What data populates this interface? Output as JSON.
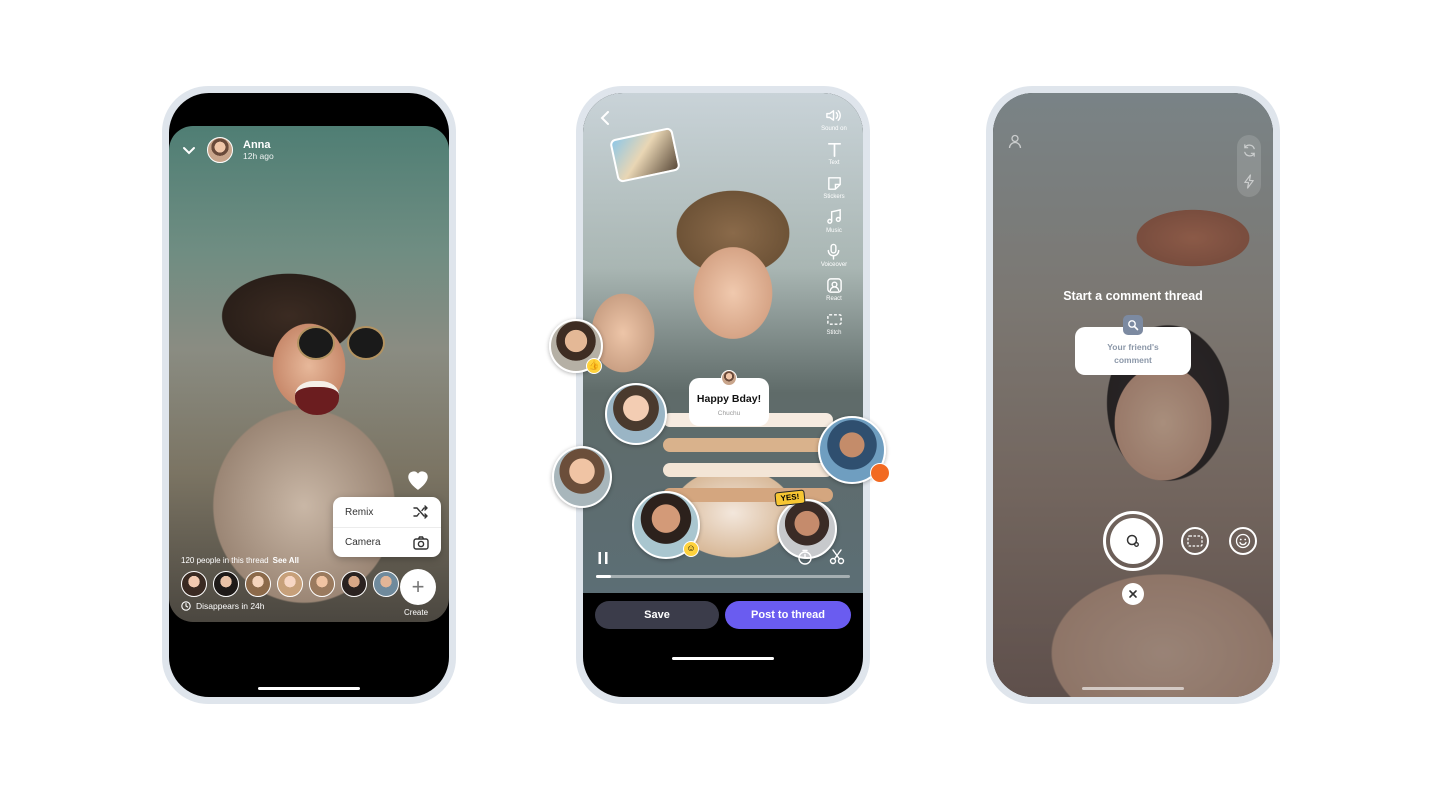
{
  "post_view": {
    "author": {
      "name": "Anna",
      "time": "12h ago"
    },
    "menu": {
      "remix_label": "Remix",
      "camera_label": "Camera"
    },
    "thread": {
      "count_text": "120 people in this thread",
      "see_all_label": "See All"
    },
    "participants": [
      "participant-1",
      "participant-2",
      "participant-3",
      "participant-4",
      "participant-5",
      "participant-6",
      "participant-7"
    ],
    "create_label": "Create",
    "disappears_text": "Disappears in 24h"
  },
  "editor": {
    "tools": [
      {
        "name": "sound",
        "label": "Sound on",
        "icon": "speaker-icon"
      },
      {
        "name": "text",
        "label": "Text",
        "icon": "text-icon"
      },
      {
        "name": "stickers",
        "label": "Stickers",
        "icon": "sticker-icon"
      },
      {
        "name": "music",
        "label": "Music",
        "icon": "music-icon"
      },
      {
        "name": "voiceover",
        "label": "Voiceover",
        "icon": "mic-icon"
      },
      {
        "name": "react",
        "label": "React",
        "icon": "react-icon"
      },
      {
        "name": "stitch",
        "label": "Stitch",
        "icon": "stitch-icon"
      }
    ],
    "comment_bubble": {
      "title": "Happy Bday!",
      "author": "Chuchu"
    },
    "yes_sticker": "YES!",
    "progress_fraction": 0.06,
    "save_label": "Save",
    "post_label": "Post to thread"
  },
  "camera": {
    "title": "Start a comment thread",
    "card_text_line1": "Your friend's",
    "card_text_line2": "comment"
  },
  "colors": {
    "accent_purple": "#6a5cf0",
    "save_dark": "#3b3c4a",
    "frame": "#dfe5ec"
  }
}
